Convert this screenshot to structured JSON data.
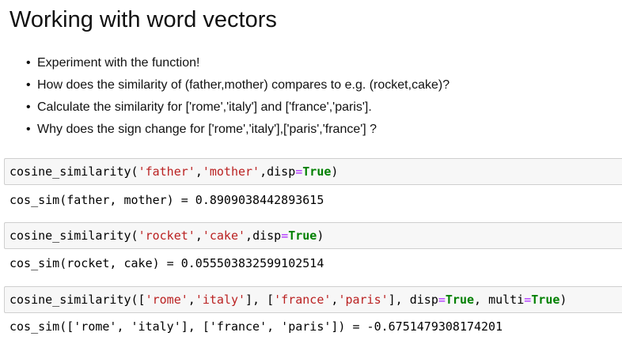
{
  "heading": "Working with word vectors",
  "bullets": [
    "Experiment with the function!",
    "How does the similarity of (father,mother) compares to e.g. (rocket,cake)?",
    "Calculate the similarity for ['rome','italy'] and ['france','paris'].",
    "Why does the sign change for ['rome','italy'],['paris','france'] ?"
  ],
  "bullet_glyph": "•",
  "cells": [
    {
      "input": {
        "func": "cosine_similarity",
        "open": "(",
        "arg1": "'father'",
        "sep1": ",",
        "arg2": "'mother'",
        "sep2": ",",
        "kw": "disp",
        "eq": "=",
        "val": "True",
        "close": ")"
      },
      "output": "cos_sim(father, mother) = 0.8909038442893615"
    },
    {
      "input": {
        "func": "cosine_similarity",
        "open": "(",
        "arg1": "'rocket'",
        "sep1": ",",
        "arg2": "'cake'",
        "sep2": ",",
        "kw": "disp",
        "eq": "=",
        "val": "True",
        "close": ")"
      },
      "output": "cos_sim(rocket, cake) = 0.055503832599102514"
    },
    {
      "input": {
        "func": "cosine_similarity",
        "open": "([",
        "arg1": "'rome'",
        "sep1": ",",
        "arg2": "'italy'",
        "mid": "], [",
        "arg3": "'france'",
        "sep3": ",",
        "arg4": "'paris'",
        "mid2": "], ",
        "kw": "disp",
        "eq": "=",
        "val": "True",
        "sep4": ", ",
        "kw2": "multi",
        "eq2": "=",
        "val2": "True",
        "close": ")"
      },
      "output": "cos_sim(['rome', 'italy'], ['france', 'paris']) = -0.6751479308174201"
    }
  ],
  "colors": {
    "string": "#ba2121",
    "operator": "#aa22ff",
    "keyword": "#008000",
    "cell_background": "#f7f7f7",
    "cell_border": "#cfcfcf"
  }
}
